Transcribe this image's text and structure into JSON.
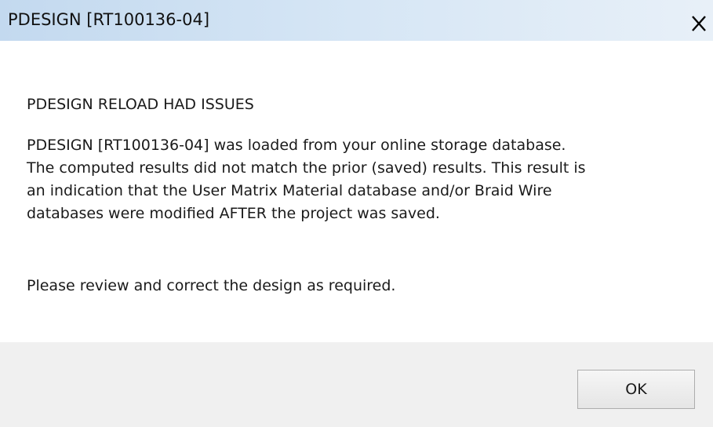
{
  "window": {
    "title": "PDESIGN [RT100136-04]",
    "close_icon": "close-icon"
  },
  "message": {
    "heading": "PDESIGN RELOAD HAD ISSUES",
    "body_lines": [
      "PDESIGN [RT100136-04] was loaded from your online storage database.",
      "The computed results did not match the prior (saved) results. This result is",
      "an indication that the User Matrix Material database and/or Braid Wire",
      "databases were modified AFTER the project was saved."
    ],
    "instruction": "Please review and correct the design as required."
  },
  "buttons": {
    "ok_label": "OK"
  }
}
